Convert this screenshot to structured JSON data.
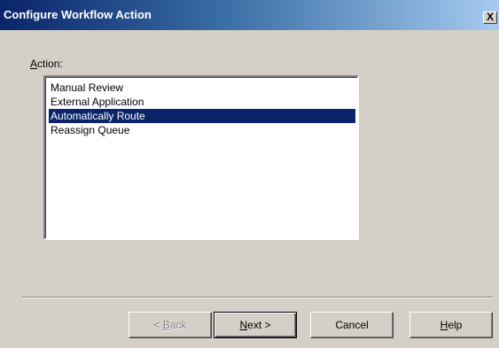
{
  "window": {
    "title": "Configure Workflow Action",
    "close_glyph": "X"
  },
  "action": {
    "label_accel": "A",
    "label_rest": "ction:",
    "items": [
      {
        "label": "Manual Review",
        "selected": false
      },
      {
        "label": "External Application",
        "selected": false
      },
      {
        "label": "Automatically Route",
        "selected": true
      },
      {
        "label": "Reassign Queue",
        "selected": false
      }
    ]
  },
  "buttons": {
    "back": {
      "prefix": "< ",
      "accel": "B",
      "rest": "ack",
      "enabled": false
    },
    "next": {
      "prefix": "",
      "accel": "N",
      "rest": "ext >",
      "enabled": true
    },
    "cancel": {
      "label": "Cancel"
    },
    "help": {
      "accel": "H",
      "rest": "elp"
    }
  },
  "colors": {
    "title_start": "#0a246a",
    "title_end": "#a6caf0",
    "selection": "#0a246a",
    "face": "#d4d0c8"
  }
}
